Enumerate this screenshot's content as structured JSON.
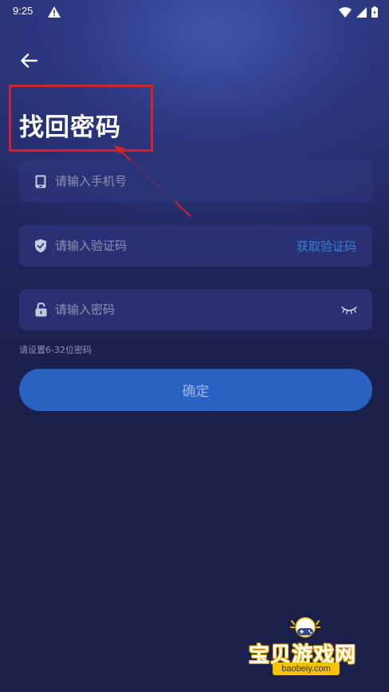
{
  "status_bar": {
    "time": "9:25",
    "icons": [
      "warning-icon",
      "wifi-icon",
      "signal-icon",
      "battery-icon"
    ]
  },
  "header": {
    "back_icon": "back-arrow-icon",
    "title": "找回密码"
  },
  "form": {
    "phone": {
      "icon": "phone-icon",
      "placeholder": "请输入手机号",
      "value": ""
    },
    "code": {
      "icon": "shield-check-icon",
      "placeholder": "请输入验证码",
      "value": "",
      "action_label": "获取验证码"
    },
    "password": {
      "icon": "lock-icon",
      "placeholder": "请输入密码",
      "value": "",
      "toggle_icon": "eye-closed-icon"
    },
    "hint": "请设置6-32位密码",
    "submit_label": "确定"
  },
  "watermark": {
    "title": "宝贝游戏网",
    "url": "baobeiy.com"
  },
  "colors": {
    "accent": "#2962c2",
    "link": "#3a7fd8",
    "field_bg": "#2c3478",
    "annotation": "#d4212a",
    "background": "#1a2049"
  }
}
